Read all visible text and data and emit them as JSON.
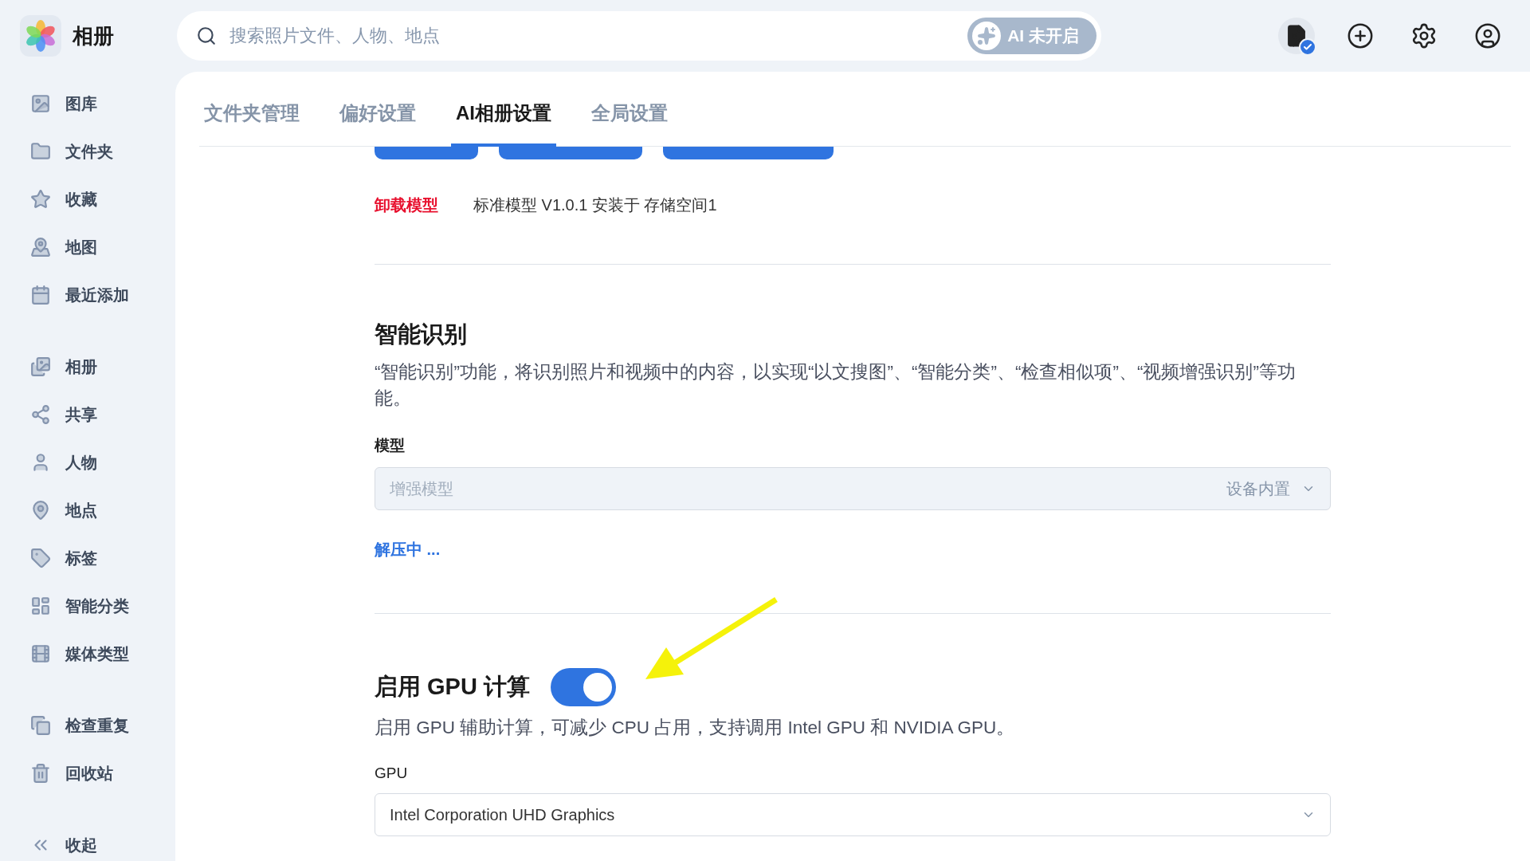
{
  "app": {
    "title": "相册"
  },
  "search": {
    "placeholder": "搜索照片文件、人物、地点"
  },
  "ai_badge": {
    "label": "AI 未开启",
    "on": false
  },
  "sidebar": {
    "groups": [
      {
        "items": [
          {
            "label": "图库",
            "selected": false
          },
          {
            "label": "文件夹",
            "selected": false
          },
          {
            "label": "收藏",
            "selected": false
          },
          {
            "label": "地图",
            "selected": false
          },
          {
            "label": "最近添加",
            "selected": false
          }
        ]
      },
      {
        "items": [
          {
            "label": "相册",
            "selected": false
          },
          {
            "label": "共享",
            "selected": false
          },
          {
            "label": "人物",
            "selected": false
          },
          {
            "label": "地点",
            "selected": false
          },
          {
            "label": "标签",
            "selected": false
          },
          {
            "label": "智能分类",
            "selected": false
          },
          {
            "label": "媒体类型",
            "selected": false
          }
        ]
      },
      {
        "items": [
          {
            "label": "检查重复",
            "selected": false
          },
          {
            "label": "回收站",
            "selected": false
          }
        ]
      }
    ],
    "collapse": "收起"
  },
  "tabs": [
    {
      "label": "文件夹管理",
      "selected": false
    },
    {
      "label": "偏好设置",
      "selected": false
    },
    {
      "label": "AI相册设置",
      "selected": true
    },
    {
      "label": "全局设置",
      "selected": false
    }
  ],
  "model_status": {
    "action": "卸载模型",
    "info": "标准模型 V1.0.1 安装于 存储空间1"
  },
  "recognition": {
    "title": "智能识别",
    "description": "“智能识别”功能，将识别照片和视频中的内容，以实现“以文搜图”、“智能分类”、“检查相似项”、“视频增强识别”等功能。",
    "model_label": "模型",
    "model_select": {
      "value": "增强模型",
      "source": "设备内置",
      "disabled": true
    },
    "status": "解压中 ..."
  },
  "gpu": {
    "title": "启用 GPU 计算",
    "on": true,
    "description": "启用 GPU 辅助计算，可减少 CPU 占用，支持调用 Intel GPU 和 NVIDIA GPU。",
    "label": "GPU",
    "select": {
      "value": "Intel Corporation UHD Graphics",
      "disabled": false
    }
  }
}
